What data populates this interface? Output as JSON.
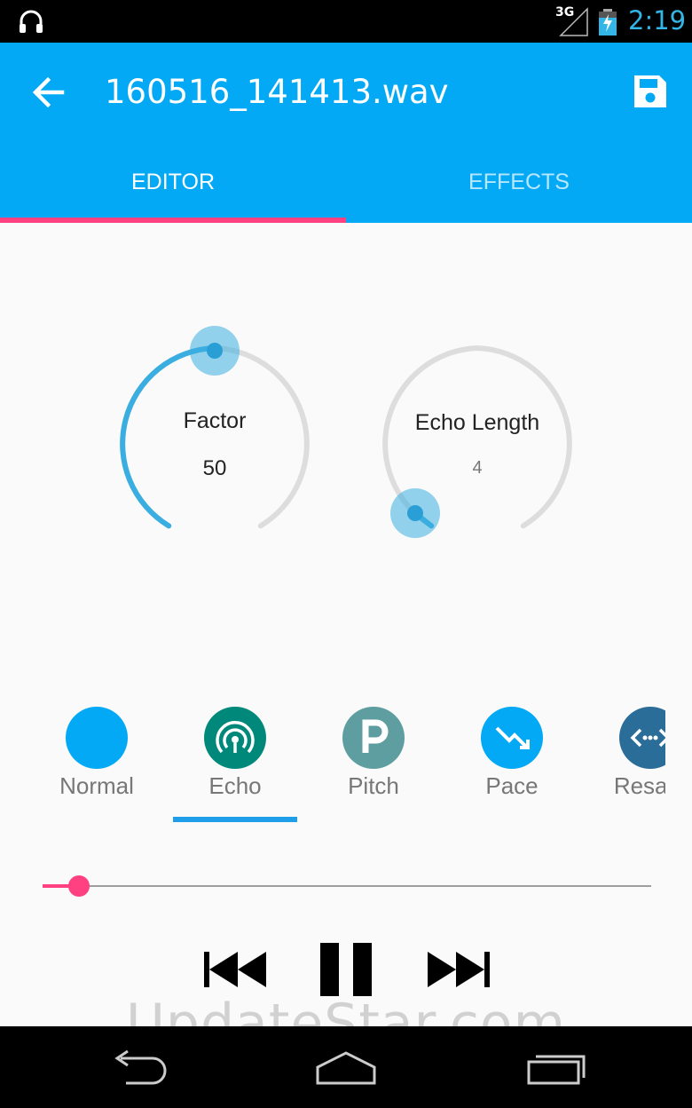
{
  "status_bar": {
    "time": "2:19",
    "network": "3G",
    "icons": [
      "headset-icon",
      "signal-icon",
      "battery-charging-icon"
    ]
  },
  "app_bar": {
    "title": "160516_141413.wav",
    "back_icon": "arrow-back-icon",
    "save_icon": "save-icon"
  },
  "tabs": [
    {
      "label": "EDITOR",
      "selected": true
    },
    {
      "label": "EFFECTS",
      "selected": false
    }
  ],
  "knobs": [
    {
      "label": "Factor",
      "value": "50"
    },
    {
      "label": "Echo Length",
      "value": "4"
    }
  ],
  "effects": [
    {
      "label": "Normal",
      "icon": "normal-icon",
      "color": "#03a9f4"
    },
    {
      "label": "Echo",
      "icon": "echo-broadcast-icon",
      "color": "#00897b",
      "selected": true
    },
    {
      "label": "Pitch",
      "icon": "pitch-p-icon",
      "color": "#5e9ea0"
    },
    {
      "label": "Pace",
      "icon": "pace-trend-down-icon",
      "color": "#03a9f4"
    },
    {
      "label": "Resam",
      "icon": "resample-icon",
      "color": "#2b6d99"
    }
  ],
  "playback": {
    "progress": 0.06,
    "controls": [
      "skip-previous-icon",
      "pause-icon",
      "skip-next-icon"
    ]
  },
  "watermark": "UpdateStar.com",
  "colors": {
    "primary": "#03a9f4",
    "accent": "#ff4081",
    "knob_active": "#3aaee0",
    "knob_track": "#dddddd"
  }
}
